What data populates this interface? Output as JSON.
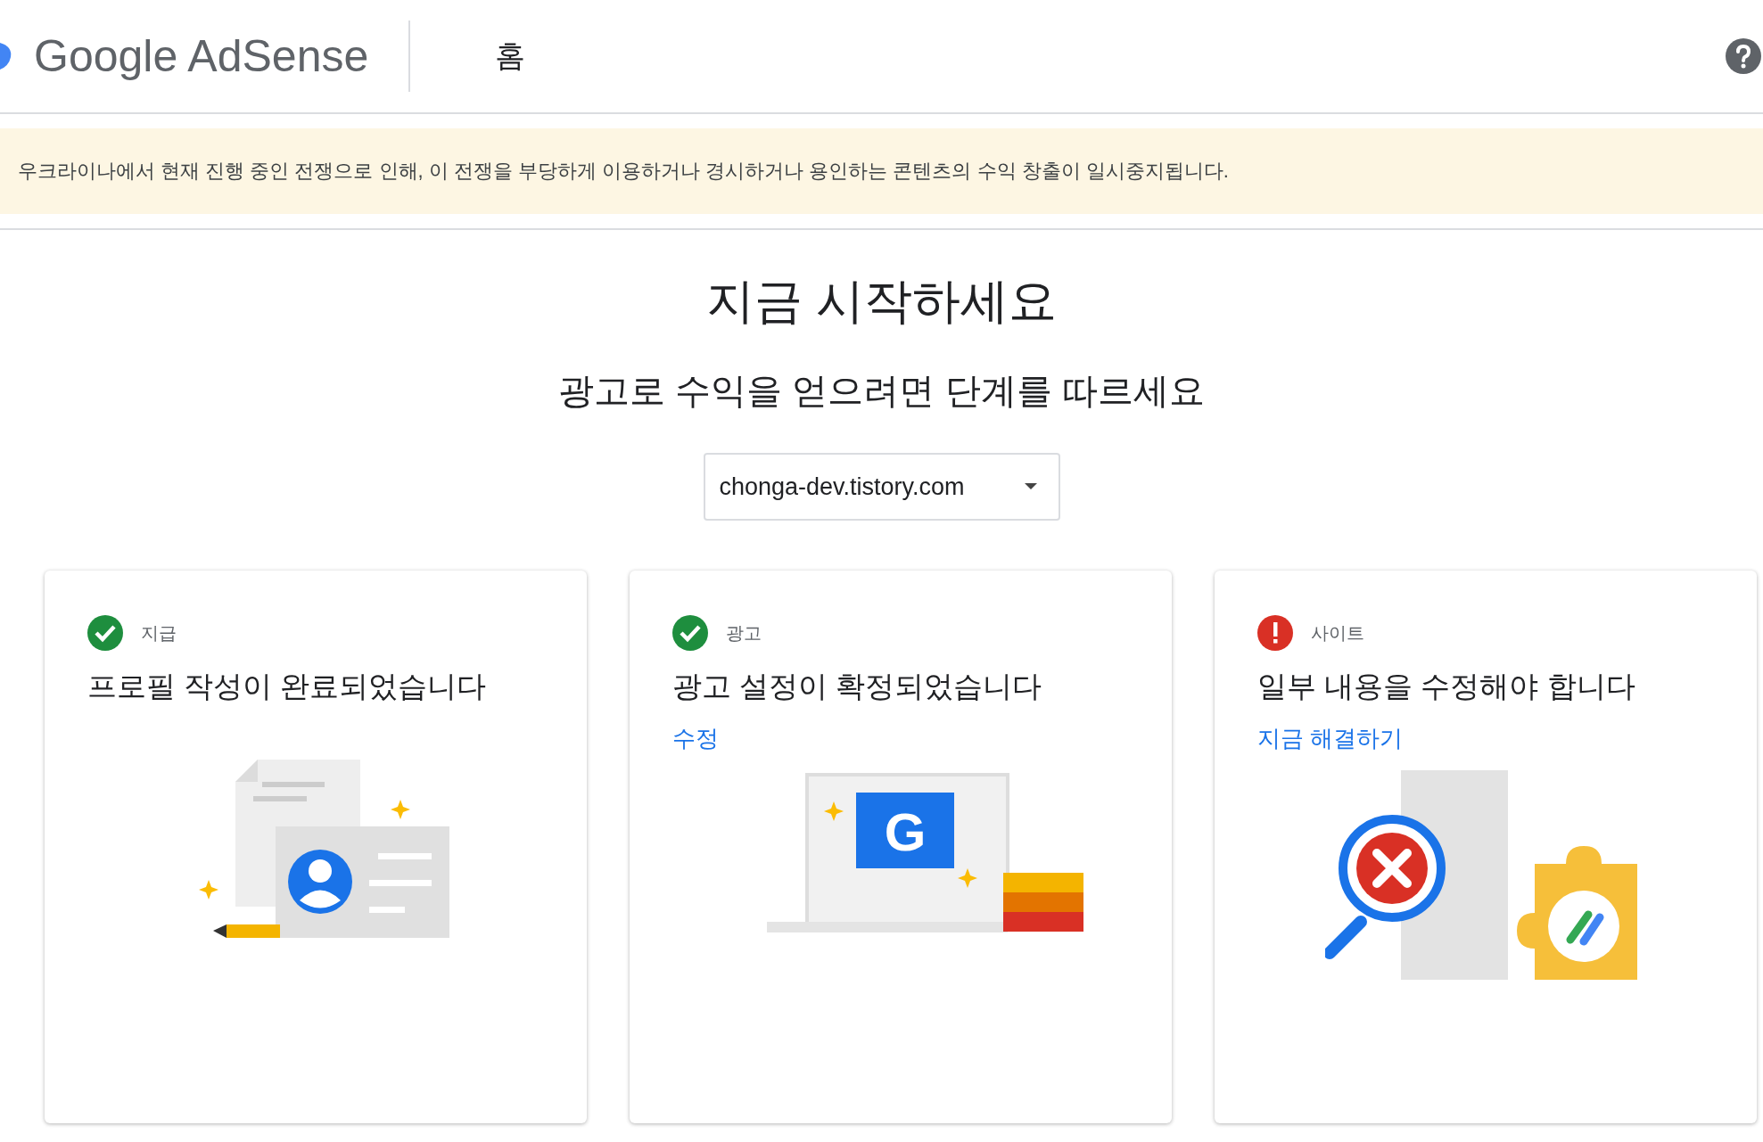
{
  "header": {
    "logo": "Google AdSense",
    "nav_item": "홈"
  },
  "banner": {
    "text": "우크라이나에서 현재 진행 중인 전쟁으로 인해, 이 전쟁을 부당하게 이용하거나 경시하거나 용인하는 콘텐츠의 수익 창출이 일시중지됩니다."
  },
  "title": "지금 시작하세요",
  "subtitle": "광고로 수익을 얻으려면 단계를 따르세요",
  "site_select": {
    "value": "chonga-dev.tistory.com"
  },
  "cards": [
    {
      "kind": "profile",
      "completed": true,
      "label": "지급",
      "heading": "프로필 작성이 완료되었습니다"
    },
    {
      "kind": "ads",
      "completed": true,
      "label": "광고",
      "heading": "광고 설정이 확정되었습니다",
      "link": "수정",
      "ad_logo": "G"
    },
    {
      "kind": "site",
      "completed": false,
      "label": "사이트",
      "heading": "일부 내용을 수정해야 합니다",
      "link": "지금 해결하기"
    }
  ]
}
